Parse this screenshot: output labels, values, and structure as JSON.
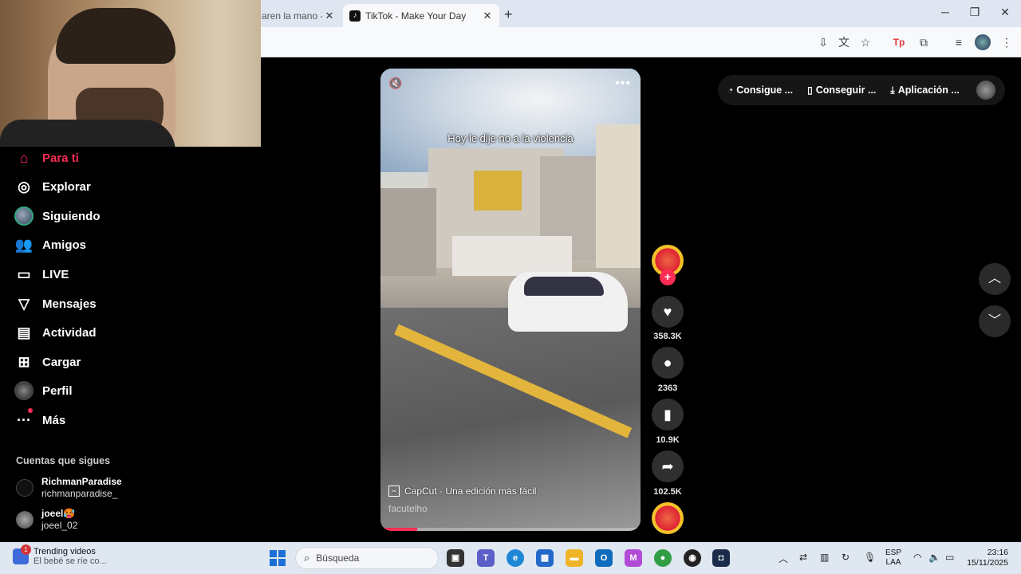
{
  "browser": {
    "tabs": [
      {
        "title": "aren la mano - Y",
        "active": false
      },
      {
        "title": "TikTok - Make Your Day",
        "active": true
      }
    ],
    "new_tab": "+",
    "window": {
      "minimize": "─",
      "restore": "❐",
      "close": "✕"
    }
  },
  "sidebar": {
    "items": [
      {
        "label": "Para ti",
        "icon": "home-icon"
      },
      {
        "label": "Explorar",
        "icon": "compass-icon"
      },
      {
        "label": "Siguiendo",
        "icon": "following-avatar-icon"
      },
      {
        "label": "Amigos",
        "icon": "friends-icon"
      },
      {
        "label": "LIVE",
        "icon": "live-tv-icon"
      },
      {
        "label": "Mensajes",
        "icon": "messages-icon"
      },
      {
        "label": "Actividad",
        "icon": "activity-icon"
      },
      {
        "label": "Cargar",
        "icon": "upload-icon"
      },
      {
        "label": "Perfil",
        "icon": "profile-avatar-icon"
      },
      {
        "label": "Más",
        "icon": "more-dots-icon"
      }
    ],
    "following_title": "Cuentas que sigues",
    "following": [
      {
        "name": "RichmanParadise",
        "handle": "richmanparadise_"
      },
      {
        "name": "joeel🥵",
        "handle": "joeel_02"
      }
    ]
  },
  "video": {
    "caption": "Hoy le dije no a la violencia",
    "capcut_label": "CapCut · Una edición más fácil",
    "author": "facutelho",
    "progress": 0.14
  },
  "actions": {
    "likes": "358.3K",
    "comments": "2363",
    "saves": "10.9K",
    "shares": "102.5K"
  },
  "promo": {
    "items": [
      "Consigue ...",
      "Conseguir ...",
      "Aplicación ..."
    ]
  },
  "taskbar": {
    "news_title": "Trending videos",
    "news_sub": "El bebé se ríe co...",
    "news_badge": "1",
    "search_placeholder": "Búsqueda",
    "lang_top": "ESP",
    "lang_bottom": "LAA",
    "time": "23:16",
    "date": "15/11/2025"
  },
  "colors": {
    "accent": "#fe2c55",
    "background": "#000000"
  }
}
